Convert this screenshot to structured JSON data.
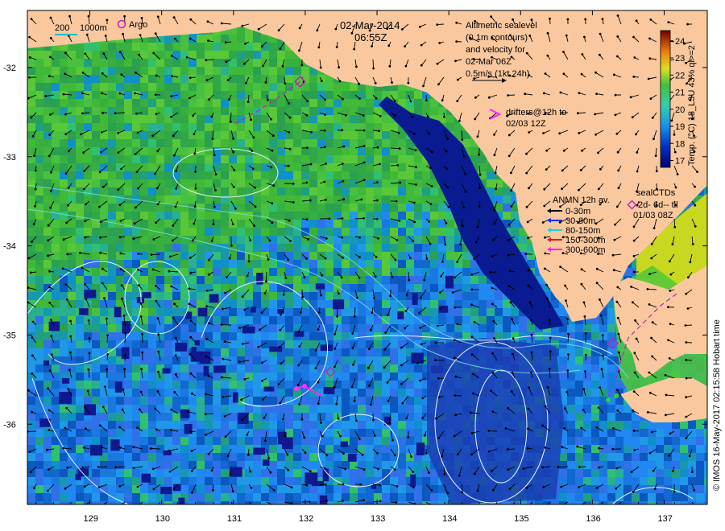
{
  "title": {
    "date": "02-Mar-2014",
    "time": "06:55Z"
  },
  "scale_legend": {
    "label_a": "200",
    "label_b": "1000m",
    "argo_label": "Argo"
  },
  "altimetry": {
    "lines": [
      "Altimetric sealevel",
      "(0.1m contours)",
      "and velocity for",
      "02-Mar 06Z"
    ],
    "scale_label": "0.5m/s (1kt 24h)"
  },
  "drifters": {
    "lines": [
      "drifters@12h to",
      "02/03 12Z"
    ]
  },
  "anmn": {
    "title": "ANMN 12h av.",
    "items": [
      {
        "label": "0-30m",
        "color": "#000000"
      },
      {
        "label": "30-80m",
        "color": "#1030ff"
      },
      {
        "label": "80-150m",
        "color": "#20d0e0"
      },
      {
        "label": "150-300m",
        "color": "#d02020"
      },
      {
        "label": "300-600m",
        "color": "#ff20ff"
      }
    ]
  },
  "sealctds": {
    "lines": [
      "sealCTDs",
      "2d- 6d-- til",
      "01/03 08Z"
    ]
  },
  "colorbar": {
    "ticks": [
      "24",
      "23",
      "22",
      "21",
      "20",
      "19",
      "18",
      "17"
    ],
    "label": "Temp. (°C) 18_L3U 43% ql>=2"
  },
  "credit": "© IMOS 16-May-2017 02:15:58 Hobart time",
  "chart_data": {
    "type": "heatmap",
    "x_label": "",
    "y_label": "",
    "x_ticks": [
      "129",
      "130",
      "131",
      "132",
      "133",
      "134",
      "135",
      "136",
      "137"
    ],
    "y_ticks": [
      "-32",
      "-33",
      "-34",
      "-35",
      "-36"
    ],
    "xlim": [
      128.13,
      137.6
    ],
    "ylim": [
      -36.9,
      -31.36
    ],
    "colorbar_range": [
      16.6,
      24.6
    ],
    "colors": {
      "land": "#f9c89e",
      "warm": "#40c040",
      "cool": "#2070e0",
      "cold": "#0a1a90"
    }
  }
}
